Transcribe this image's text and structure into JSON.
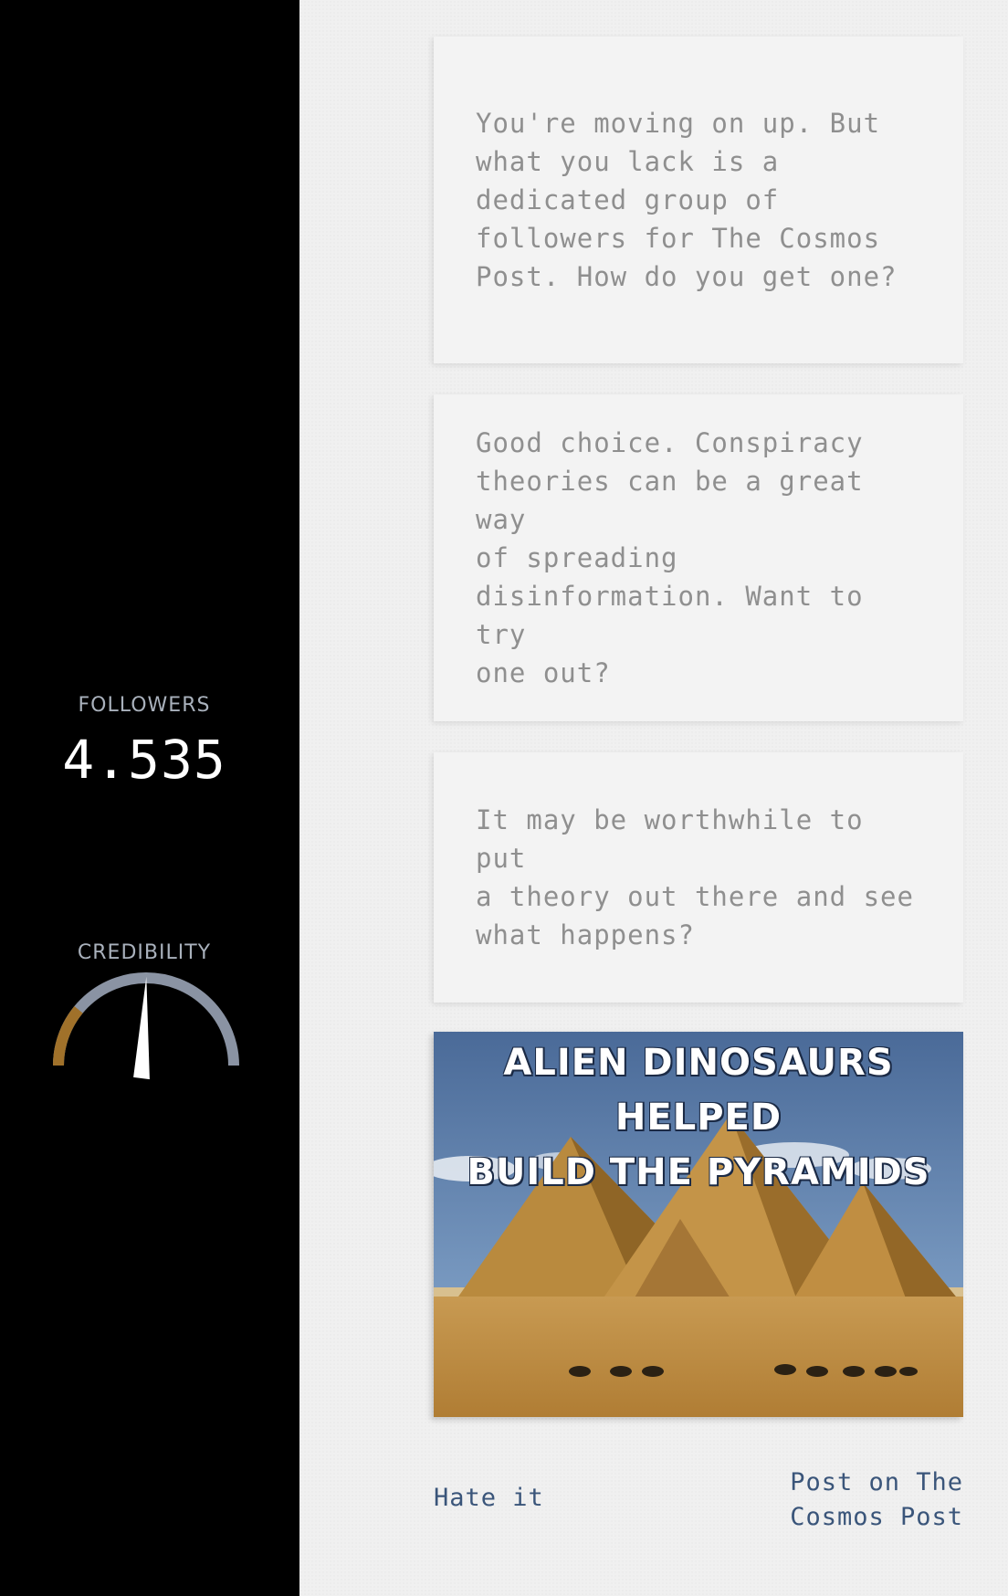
{
  "stats": {
    "followers_label": "FOLLOWERS",
    "followers_value": "4.535",
    "credibility_label": "CREDIBILITY",
    "credibility_level": 0.54
  },
  "messages": [
    {
      "text": "You're moving on up. But\nwhat you lack is a\ndedicated group of\nfollowers for The Cosmos\nPost. How do you get one?"
    },
    {
      "text": "Good choice. Conspiracy\ntheories can be a great way\nof spreading\ndisinformation. Want to try\none out?"
    },
    {
      "text": "It may be worthwhile to put\na theory out there and see\nwhat happens?"
    }
  ],
  "meme": {
    "headline_line1": "ALIEN DINOSAURS HELPED",
    "headline_line2": "BUILD THE PYRAMIDS"
  },
  "actions": {
    "hate_label": "Hate it",
    "post_label": "Post on The\nCosmos Post"
  },
  "colors": {
    "sidebar_bg": "#000000",
    "feed_bg": "#f0f0f0",
    "card_bg": "#f3f3f3",
    "card_text": "#8f8f8f",
    "action_text": "#3a557a",
    "gauge_track": "#8a93a3",
    "gauge_fill": "#a0712a",
    "gauge_needle": "#ffffff"
  }
}
